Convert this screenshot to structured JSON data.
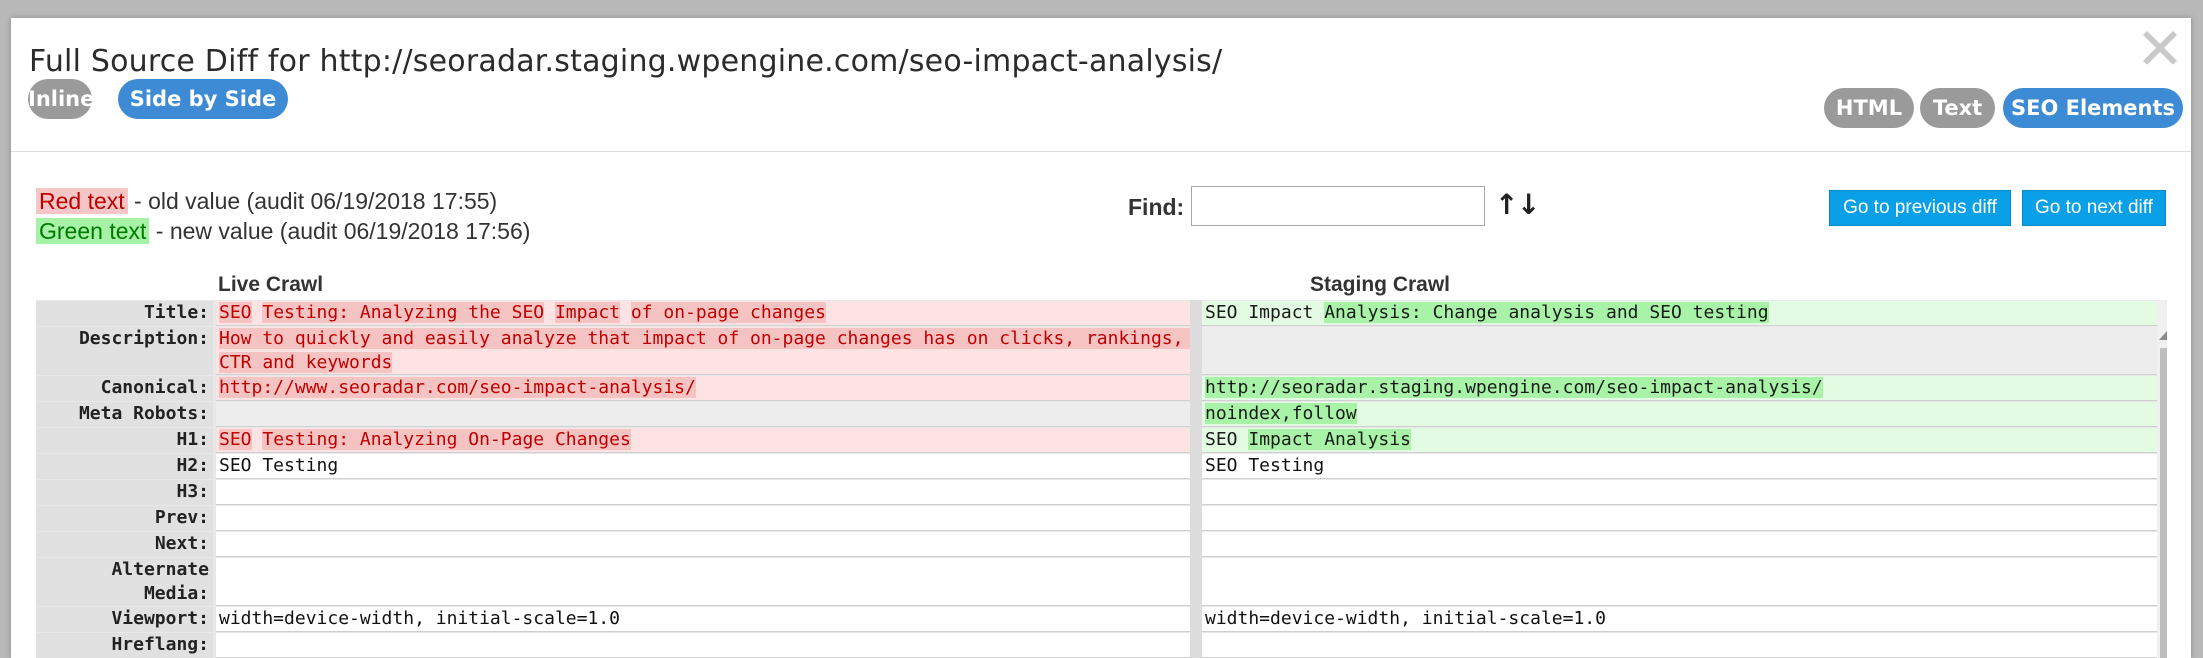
{
  "dialog": {
    "title": "Full Source Diff for http://seoradar.staging.wpengine.com/seo-impact-analysis/",
    "close_glyph": "✕",
    "view_modes": [
      "Inline",
      "Side by Side"
    ],
    "selected_view_mode": "Side by Side",
    "content_modes": [
      "HTML",
      "Text",
      "SEO Elements"
    ],
    "selected_content_mode": "SEO Elements"
  },
  "legend": {
    "old_swatch": "Red text",
    "old_desc": " - old value (audit 06/19/2018 17:55)",
    "new_swatch": "Green text",
    "new_desc": " - new value (audit 06/19/2018 17:56)"
  },
  "find": {
    "label": "Find:",
    "value": "",
    "up_arrow": "↑",
    "down_arrow": "↓"
  },
  "nav": {
    "prev_label": "Go to previous diff",
    "next_label": "Go to next diff"
  },
  "columns": {
    "left_heading": "Live Crawl",
    "right_heading": "Staging Crawl"
  },
  "rows": [
    {
      "label": "Title:",
      "left_status": "old",
      "left": [
        {
          "t": "SEO",
          "h": true
        },
        {
          "t": " ",
          "h": false
        },
        {
          "t": "Testing: Analyzing the SEO",
          "h": true
        },
        {
          "t": " ",
          "h": false
        },
        {
          "t": "Impact",
          "h": true
        },
        {
          "t": " ",
          "h": false
        },
        {
          "t": "of on-page changes",
          "h": true
        }
      ],
      "right_status": "new",
      "right": [
        {
          "t": "SEO Impact ",
          "h": false
        },
        {
          "t": "Analysis: Change analysis and SEO testing",
          "h": true
        }
      ]
    },
    {
      "label": "Description:",
      "left_status": "old",
      "left": [
        {
          "t": "How to quickly and easily analyze that impact of on-page changes has on clicks, rankings, CTR and keywords",
          "h": true
        }
      ],
      "right_status": "empty",
      "right": []
    },
    {
      "label": "Canonical:",
      "left_status": "old",
      "left": [
        {
          "t": "http://www.seoradar.com/seo-impact-analysis/",
          "h": true
        }
      ],
      "right_status": "new",
      "right": [
        {
          "t": "http://seoradar.staging.wpengine.com/seo-impact-analysis/",
          "h": true
        }
      ]
    },
    {
      "label": "Meta Robots:",
      "left_status": "empty",
      "left": [],
      "right_status": "new",
      "right": [
        {
          "t": "noindex,follow",
          "h": true
        }
      ]
    },
    {
      "label": "H1:",
      "left_status": "old",
      "left": [
        {
          "t": "SEO",
          "h": true
        },
        {
          "t": " ",
          "h": false
        },
        {
          "t": "Testing: Analyzing On-Page Changes",
          "h": true
        }
      ],
      "right_status": "new",
      "right": [
        {
          "t": "SEO ",
          "h": false
        },
        {
          "t": "Impact Analysis",
          "h": true
        }
      ]
    },
    {
      "label": "H2:",
      "left_status": "plain",
      "left": [
        {
          "t": "SEO Testing",
          "h": false
        }
      ],
      "right_status": "plain",
      "right": [
        {
          "t": "SEO Testing",
          "h": false
        }
      ]
    },
    {
      "label": "H3:",
      "left_status": "plain",
      "left": [],
      "right_status": "plain",
      "right": []
    },
    {
      "label": "Prev:",
      "left_status": "plain",
      "left": [],
      "right_status": "plain",
      "right": []
    },
    {
      "label": "Next:",
      "left_status": "plain",
      "left": [],
      "right_status": "plain",
      "right": []
    },
    {
      "label": "Alternate Media:",
      "left_status": "plain",
      "left": [],
      "right_status": "plain",
      "right": []
    },
    {
      "label": "Viewport:",
      "left_status": "plain",
      "left": [
        {
          "t": "width=device-width, initial-scale=1.0",
          "h": false
        }
      ],
      "right_status": "plain",
      "right": [
        {
          "t": "width=device-width, initial-scale=1.0",
          "h": false
        }
      ]
    },
    {
      "label": "Hreflang:",
      "left_status": "plain",
      "left": [],
      "right_status": "plain",
      "right": []
    }
  ],
  "colors": {
    "pill_gray": "#9a9a9a",
    "pill_blue": "#3d8bd4",
    "nav_blue": "#0aa0e8",
    "old_bg": "#fde3e3",
    "old_highlight": "#f6c3c3",
    "old_text": "#c00000",
    "new_bg": "#e2fbe2",
    "new_highlight": "#a8f3a8"
  },
  "icons": {
    "close": "close-icon",
    "find_up": "arrow-up-icon",
    "find_down": "arrow-down-icon"
  }
}
